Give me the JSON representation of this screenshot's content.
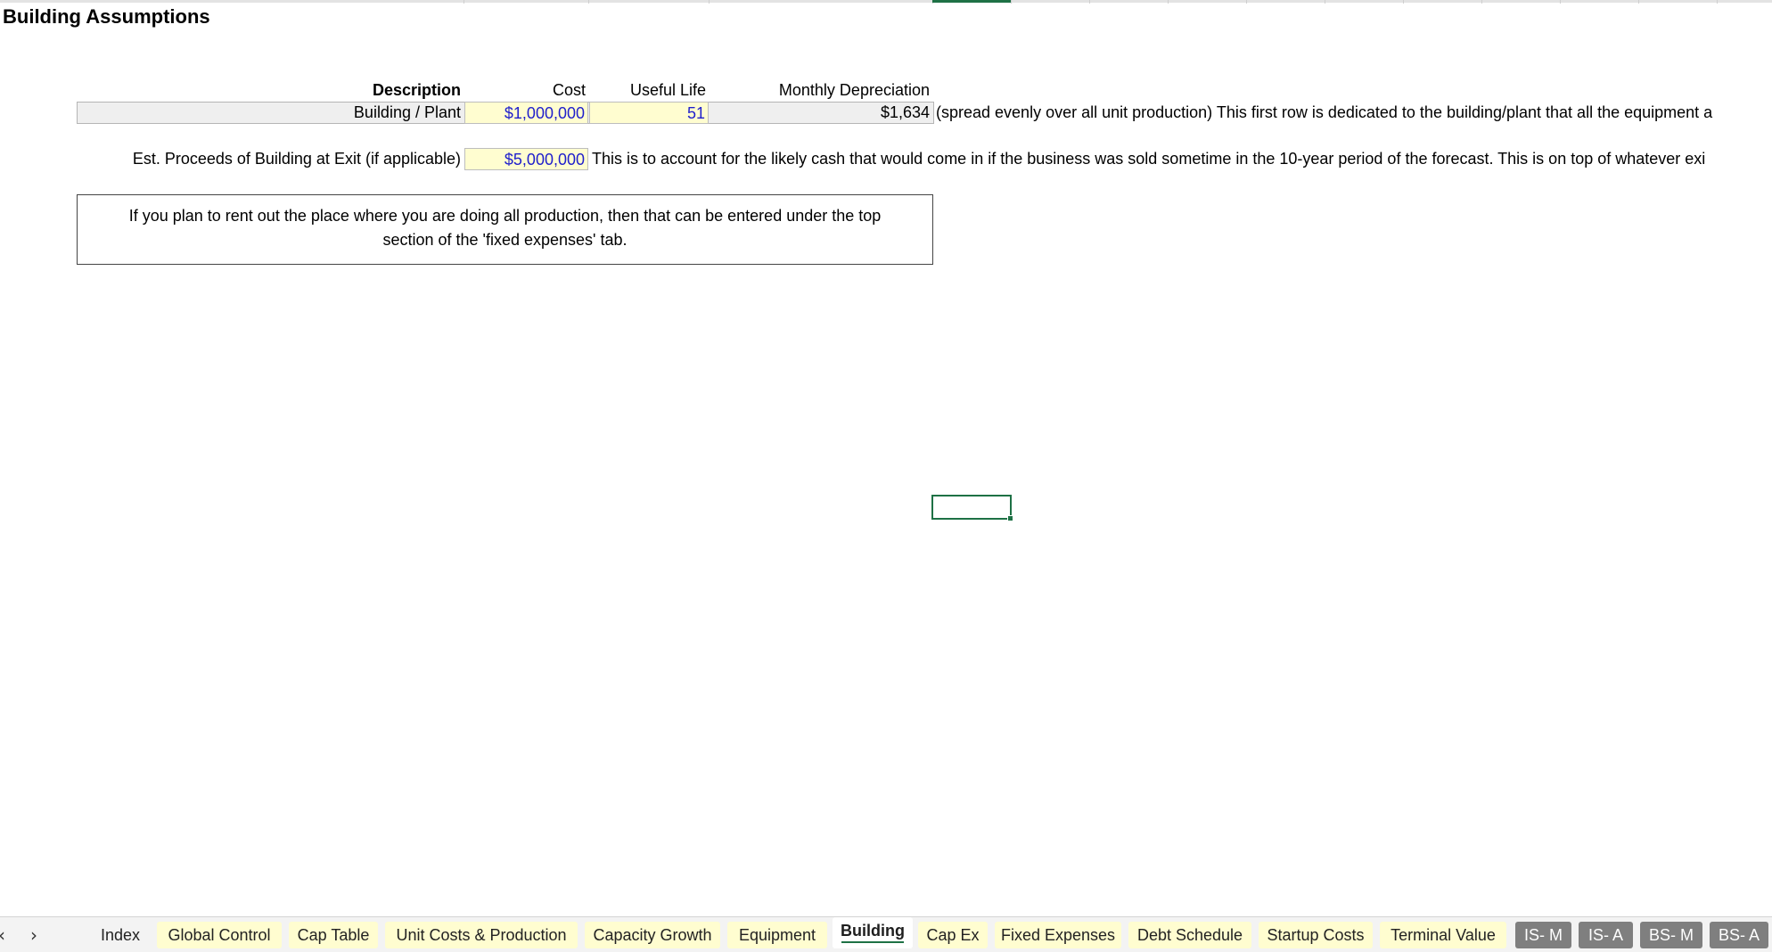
{
  "page_title": "Building Assumptions",
  "table": {
    "headers": {
      "description": "Description",
      "cost": "Cost",
      "useful_life": "Useful Life",
      "monthly_depreciation": "Monthly Depreciation"
    },
    "row": {
      "description": "Building / Plant",
      "cost": "$1,000,000",
      "useful_life": "51",
      "monthly_depreciation": "$1,634",
      "note": "(spread evenly over all unit production) This first row is dedicated to the building/plant that all the equipment a"
    }
  },
  "exit_proceeds": {
    "label": "Est. Proceeds of Building at Exit (if applicable)",
    "value": "$5,000,000",
    "note": "This is to account for the likely cash that would come in if the business was sold sometime in the 10-year period of the forecast. This is on top of whatever exi"
  },
  "note_box": {
    "line1": "If you plan to rent out the place where you are doing all production, then that can be entered under the top",
    "line2": "section of the 'fixed expenses' tab."
  },
  "tabbar": {
    "prev_arrow": "‹",
    "next_arrow": "›",
    "tabs": [
      {
        "label": "Index"
      },
      {
        "label": "Global Control"
      },
      {
        "label": "Cap Table"
      },
      {
        "label": "Unit Costs & Production"
      },
      {
        "label": "Capacity Growth"
      },
      {
        "label": "Equipment"
      },
      {
        "label": "Building"
      },
      {
        "label": "Cap Ex"
      },
      {
        "label": "Fixed Expenses"
      },
      {
        "label": "Debt Schedule"
      },
      {
        "label": "Startup Costs"
      },
      {
        "label": "Terminal Value"
      },
      {
        "label": "IS- M"
      },
      {
        "label": "IS- A"
      },
      {
        "label": "BS- M"
      },
      {
        "label": "BS- A"
      }
    ],
    "active_tab": "Building"
  },
  "colors": {
    "input_fill": "#fffdd0",
    "input_text": "#1f1fcc",
    "accent_green": "#1e7145",
    "dark_tab": "#7f7f7f"
  }
}
